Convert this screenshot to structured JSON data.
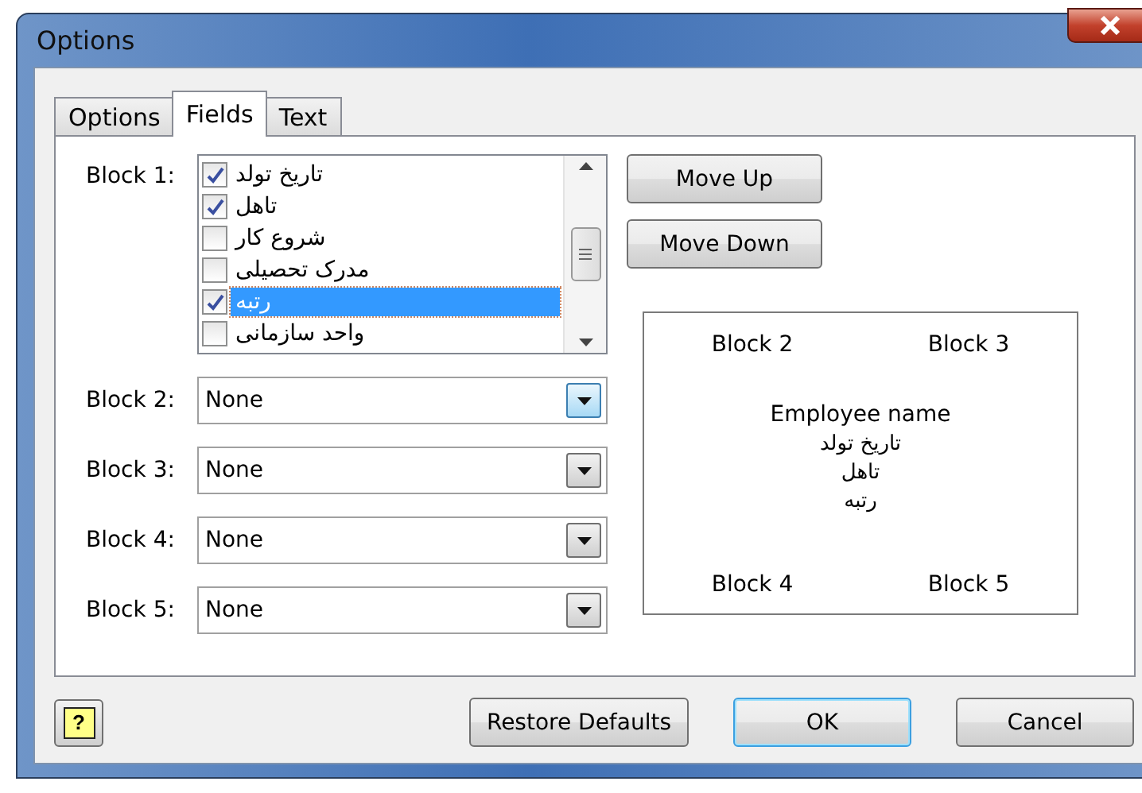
{
  "window": {
    "title": "Options"
  },
  "tabs": [
    {
      "label": "Options",
      "selected": false
    },
    {
      "label": "Fields",
      "selected": true
    },
    {
      "label": "Text",
      "selected": false
    }
  ],
  "block1": {
    "label": "Block 1:",
    "items": [
      {
        "text": "تاریخ تولد",
        "checked": true,
        "selected": false
      },
      {
        "text": "تاهل",
        "checked": true,
        "selected": false
      },
      {
        "text": "شروع کار",
        "checked": false,
        "selected": false
      },
      {
        "text": "مدرک تحصیلی",
        "checked": false,
        "selected": false
      },
      {
        "text": "رتبه",
        "checked": true,
        "selected": true
      },
      {
        "text": "واحد سازمانی",
        "checked": false,
        "selected": false
      }
    ]
  },
  "blocks": [
    {
      "label": "Block 2:",
      "value": "None",
      "focused": true
    },
    {
      "label": "Block 3:",
      "value": "None",
      "focused": false
    },
    {
      "label": "Block 4:",
      "value": "None",
      "focused": false
    },
    {
      "label": "Block 5:",
      "value": "None",
      "focused": false
    }
  ],
  "move_buttons": [
    "Move Up",
    "Move Down"
  ],
  "preview": {
    "top": [
      "Block 2",
      "Block 3"
    ],
    "lines": [
      "Employee name",
      "تاریخ تولد",
      "تاهل",
      "رتبه"
    ],
    "bottom": [
      "Block 4",
      "Block 5"
    ]
  },
  "footer": {
    "help": "?",
    "buttons": [
      {
        "label": "Restore Defaults",
        "default": false
      },
      {
        "label": "OK",
        "default": true
      },
      {
        "label": "Cancel",
        "default": false
      }
    ]
  }
}
